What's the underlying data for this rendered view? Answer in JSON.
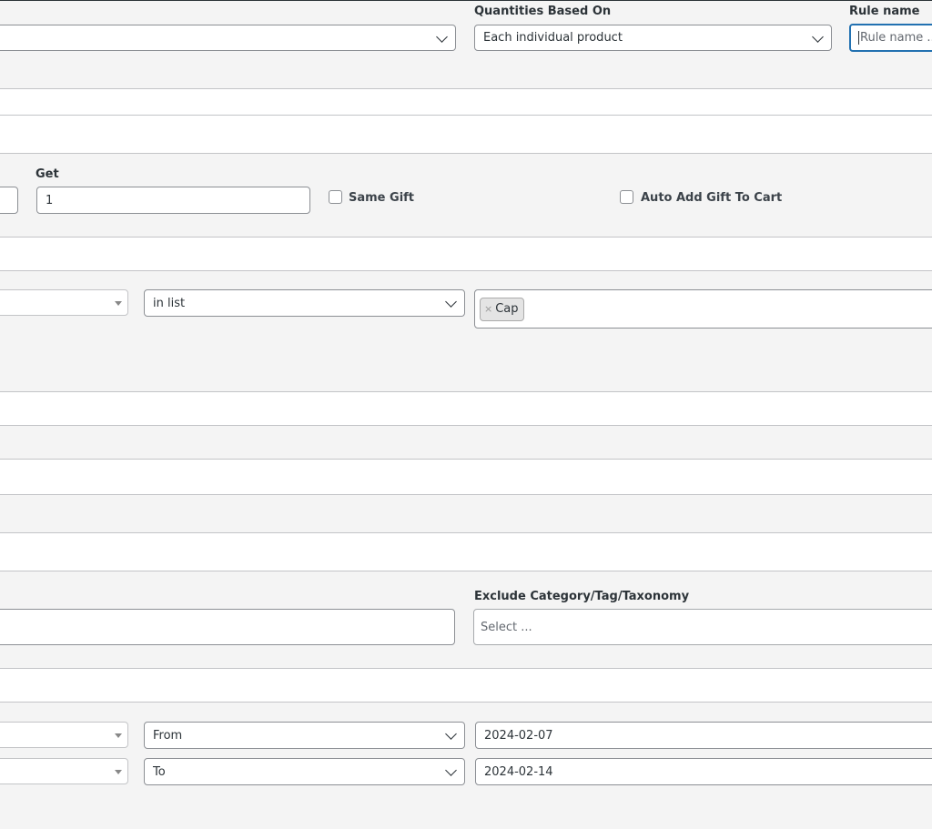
{
  "quantities": {
    "label": "Quantities Based On",
    "value": "Each individual product"
  },
  "rule_name": {
    "label": "Rule name",
    "placeholder": "Rule name ..."
  },
  "gift": {
    "get_label": "Get",
    "get_value": "1",
    "same_gift_label": "Same Gift",
    "auto_add_label": "Auto Add Gift To Cart"
  },
  "product_condition": {
    "operator": "in list",
    "tags": [
      "Cap"
    ]
  },
  "exclude": {
    "label": "Exclude Category/Tag/Taxonomy",
    "placeholder": "Select ..."
  },
  "date_conditions": [
    {
      "operator": "From",
      "value": "2024-02-07"
    },
    {
      "operator": "To",
      "value": "2024-02-14"
    }
  ]
}
